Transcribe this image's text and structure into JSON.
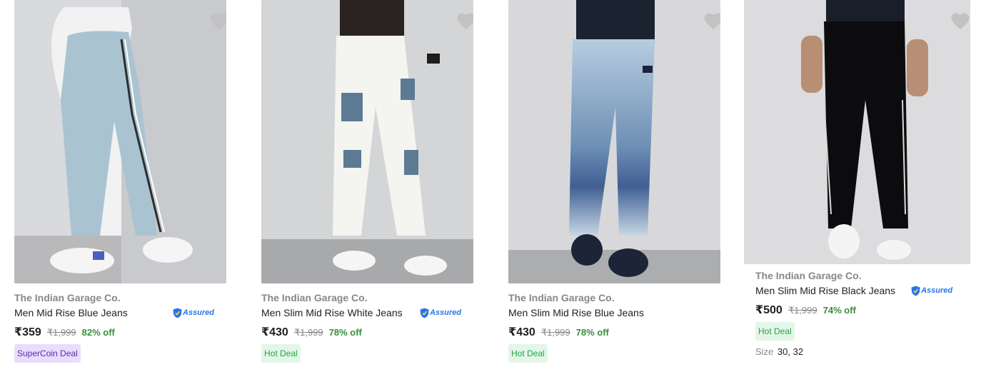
{
  "products": [
    {
      "brand": "The Indian Garage Co.",
      "name": "Men Mid Rise Blue Jeans",
      "price": "₹359",
      "mrp": "₹1,999",
      "discount": "82% off",
      "assured": "Assured",
      "badge": "SuperCoin Deal"
    },
    {
      "brand": "The Indian Garage Co.",
      "name": "Men Slim Mid Rise White Jeans",
      "price": "₹430",
      "mrp": "₹1,999",
      "discount": "78% off",
      "assured": "Assured",
      "badge": "Hot Deal"
    },
    {
      "brand": "The Indian Garage Co.",
      "name": "Men Slim Mid Rise Blue Jeans",
      "price": "₹430",
      "mrp": "₹1,999",
      "discount": "78% off",
      "badge": "Hot Deal"
    },
    {
      "brand": "The Indian Garage Co.",
      "name": "Men Slim Mid Rise Black Jeans",
      "price": "₹500",
      "mrp": "₹1,999",
      "discount": "74% off",
      "assured": "Assured",
      "badge": "Hot Deal",
      "size_label": "Size",
      "size_value": "30, 32"
    }
  ],
  "colors": {
    "discount_green": "#388e3c",
    "assured_blue": "#2874f0",
    "hot_deal_bg": "#e3f6e7",
    "supercoin_bg": "#e9dcff",
    "wishlist_heart": "#c2c2c2"
  },
  "icons": {
    "wishlist": "heart-icon",
    "assured": "assured-shield-icon"
  }
}
